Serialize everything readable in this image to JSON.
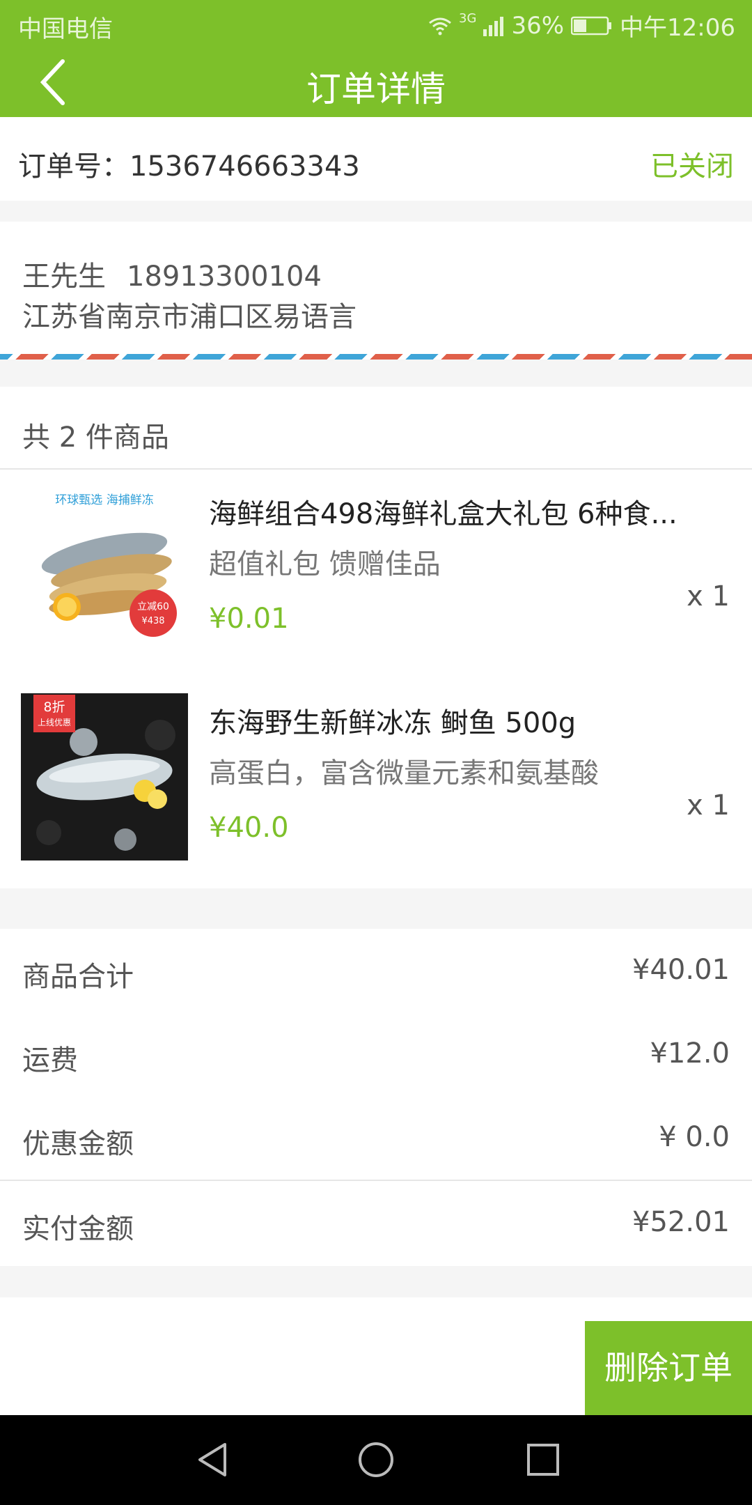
{
  "status_bar": {
    "carrier": "中国电信",
    "network": "3G",
    "battery": "36%",
    "time": "中午12:06"
  },
  "header": {
    "title": "订单详情",
    "back_icon": "back-arrow-icon"
  },
  "order": {
    "label_number": "订单号：1536746663343",
    "status": "已关闭"
  },
  "address": {
    "name": "王先生",
    "phone": "18913300104",
    "line": "江苏省南京市浦口区易语言"
  },
  "goods": {
    "count_text": "共 2 件商品",
    "items": [
      {
        "title": "海鲜组合498海鲜礼盒大礼包 6种食...",
        "subtitle": "超值礼包 馈赠佳品",
        "price": "¥0.01",
        "qty": "x 1",
        "thumb_banner": "环球甄选 海捕鲜冻",
        "thumb_badge_top": "立减60",
        "thumb_badge_bottom": "¥438"
      },
      {
        "title": "东海野生新鲜冰冻 鲥鱼  500g",
        "subtitle": "高蛋白，富含微量元素和氨基酸",
        "price": "¥40.0",
        "qty": "x 1",
        "thumb_tag_top": "8折",
        "thumb_tag_bottom": "上线优惠"
      }
    ]
  },
  "summary": {
    "rows": [
      {
        "label": "商品合计",
        "value": "¥40.01"
      },
      {
        "label": "运费",
        "value": "¥12.0"
      },
      {
        "label": "优惠金额",
        "value": "¥ 0.0"
      },
      {
        "label": "实付金额",
        "value": "¥52.01"
      }
    ]
  },
  "actions": {
    "delete_label": "删除订单"
  },
  "colors": {
    "brand_green": "#7dc02a",
    "price_green": "#7dc02a"
  }
}
